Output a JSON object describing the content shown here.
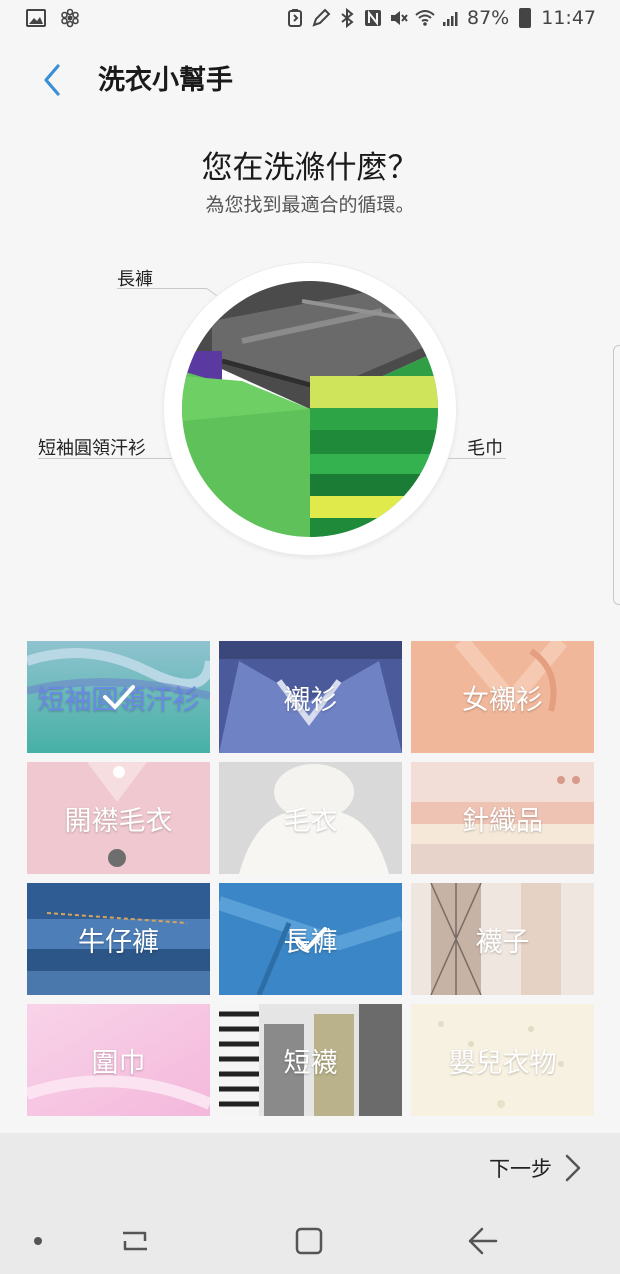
{
  "status": {
    "battery": "87%",
    "time": "11:47"
  },
  "header": {
    "title": "洗衣小幫手"
  },
  "intro": {
    "question": "您在洗滌什麼？",
    "subtitle": "為您找到最適合的循環。"
  },
  "selection": {
    "top_label": "長褲",
    "left_label": "短袖圓領汗衫",
    "right_label": "毛巾"
  },
  "tiles": [
    {
      "label": "短袖圓領汗衫",
      "selected": true
    },
    {
      "label": "襯衫",
      "selected": false
    },
    {
      "label": "女襯衫",
      "selected": false
    },
    {
      "label": "開襟毛衣",
      "selected": false
    },
    {
      "label": "毛衣",
      "selected": false
    },
    {
      "label": "針織品",
      "selected": false
    },
    {
      "label": "牛仔褲",
      "selected": false
    },
    {
      "label": "長褲",
      "selected": true
    },
    {
      "label": "襪子",
      "selected": false
    },
    {
      "label": "圍巾",
      "selected": false
    },
    {
      "label": "短襪",
      "selected": false
    },
    {
      "label": "嬰兒衣物",
      "selected": false
    }
  ],
  "footer": {
    "next_label": "下一步"
  },
  "colors": {
    "accent": "#3b8fd6",
    "footer_bg": "#eaeaea"
  }
}
